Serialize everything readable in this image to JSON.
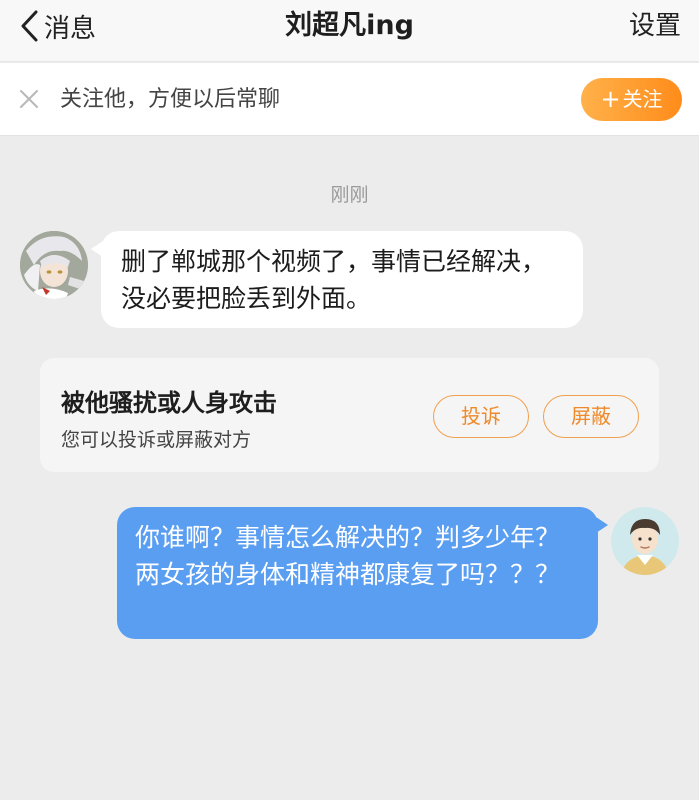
{
  "header": {
    "back_label": "消息",
    "title": "刘超凡ing",
    "settings_label": "设置"
  },
  "follow_banner": {
    "text": "关注他，方便以后常聊",
    "follow_label": "关注",
    "follow_icon": "+"
  },
  "chat": {
    "timestamp": "刚刚",
    "messages": [
      {
        "direction": "incoming",
        "text": "删了郸城那个视频了，事情已经解决，没必要把脸丢到外面。"
      },
      {
        "direction": "outgoing",
        "text": "你谁啊？事情怎么解决的？判多少年？两女孩的身体和精神都康复了吗？？？"
      }
    ]
  },
  "harassment_card": {
    "title": "被他骚扰或人身攻击",
    "subtitle": "您可以投诉或屏蔽对方",
    "report_label": "投诉",
    "block_label": "屏蔽"
  },
  "colors": {
    "accent_orange": "#ff8c1a",
    "outgoing_bubble": "#5a9ef2",
    "background": "#ececec"
  }
}
